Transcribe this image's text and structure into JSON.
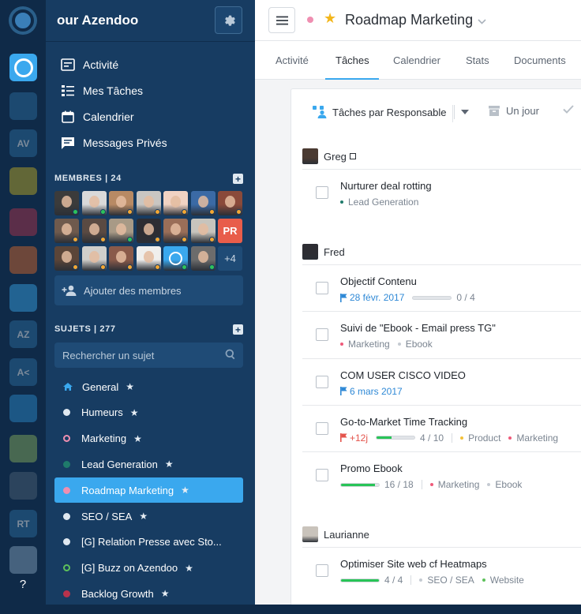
{
  "rail": {
    "workspaces": [
      {
        "label": "",
        "kind": "azendoo-active",
        "color": "#3aa8ee"
      },
      {
        "label": "",
        "kind": "logo",
        "color": "#2d6fa1"
      },
      {
        "label": "AV",
        "kind": "initials",
        "color": "#2d6fa1"
      },
      {
        "label": "",
        "kind": "logo",
        "color": "#c7b223"
      },
      {
        "label": "",
        "kind": "logo",
        "color": "#b8324c"
      },
      {
        "label": "",
        "kind": "logo",
        "color": "#e06b2b"
      },
      {
        "label": "",
        "kind": "logo",
        "color": "#3aa8ee"
      },
      {
        "label": "AZ",
        "kind": "initials",
        "color": "#2d6fa1"
      },
      {
        "label": "A<",
        "kind": "initials",
        "color": "#2d6fa1"
      },
      {
        "label": "",
        "kind": "logo",
        "color": "#2d8fd0"
      },
      {
        "label": "",
        "kind": "logo",
        "color": "#8fb35d"
      },
      {
        "label": "",
        "kind": "logo",
        "color": "#4f6377"
      },
      {
        "label": "RT",
        "kind": "initials",
        "color": "#2d6fa1"
      },
      {
        "label": "",
        "kind": "logo",
        "color": "#8aa7c0"
      }
    ],
    "help_label": "?"
  },
  "sidebar": {
    "workspace_title": "our Azendoo",
    "nav": [
      {
        "label": "Activité",
        "icon": "activity-icon"
      },
      {
        "label": "Mes Tâches",
        "icon": "tasks-list-icon"
      },
      {
        "label": "Calendrier",
        "icon": "calendar-icon"
      },
      {
        "label": "Messages Privés",
        "icon": "chat-icon"
      }
    ],
    "members_heading": "MEMBRES | 24",
    "members": [
      {
        "color": "#3b3b3b",
        "status": "#2ec35a"
      },
      {
        "color": "#d9d9d9",
        "status": "#2ec35a"
      },
      {
        "color": "#b88a64",
        "status": "#f4a732"
      },
      {
        "color": "#c9c6c2",
        "status": "#f4a732"
      },
      {
        "color": "#f1d3c3",
        "status": "#f4a732"
      },
      {
        "color": "#3b6aa5",
        "status": "#f4a732"
      },
      {
        "color": "#8a4a3a",
        "status": "#f4a732"
      },
      {
        "color": "#6f5a4d",
        "status": "#f4a732"
      },
      {
        "color": "#5a4a42",
        "status": "#f4a732"
      },
      {
        "color": "#a89a86",
        "status": "#2ec35a"
      },
      {
        "color": "#2d2d33",
        "status": "#f4a732"
      },
      {
        "color": "#9a6e58",
        "status": "#f4a732"
      },
      {
        "color": "#c7c4bd",
        "status": "#f4a732"
      },
      {
        "initials": "PR",
        "color": "#e85d4a"
      },
      {
        "color": "#5b4538",
        "status": "#f4a732"
      },
      {
        "color": "#d0cfcb",
        "status": "#f4a732"
      },
      {
        "color": "#8a5a4a",
        "status": "#f4a732"
      },
      {
        "color": "#f0efed",
        "status": "#f4a732"
      },
      {
        "color": "#3aa8ee",
        "status": "#2ec35a",
        "azendoo": true
      },
      {
        "color": "#6c6c6c",
        "status": "#2ec35a"
      },
      {
        "more": "+4"
      }
    ],
    "add_members_label": "Ajouter des membres",
    "subjects_heading": "SUJETS | 277",
    "search_placeholder": "Rechercher un sujet",
    "subjects": [
      {
        "label": "General",
        "star": "★",
        "icon": "house",
        "color": "#3aa8ee"
      },
      {
        "label": "Humeurs",
        "star": "★",
        "icon": "dot",
        "color": "#dfe8f0"
      },
      {
        "label": "Marketing",
        "star": "★",
        "icon": "ring",
        "color": "#ef8fb1"
      },
      {
        "label": "Lead Generation",
        "star": "★",
        "icon": "dot",
        "color": "#1f7b6b"
      },
      {
        "label": "Roadmap Marketing",
        "star": "★",
        "icon": "dot",
        "color": "#ef8fb1",
        "active": true
      },
      {
        "label": "SEO / SEA",
        "star": "★",
        "icon": "dot",
        "color": "#dfe8f0"
      },
      {
        "label": "[G] Relation Presse avec Sto...",
        "star": "",
        "icon": "dot",
        "color": "#dfe8f0"
      },
      {
        "label": "[G] Buzz on Azendoo",
        "star": "★",
        "icon": "ring",
        "color": "#5ec15b"
      },
      {
        "label": "Backlog Growth",
        "star": "★",
        "icon": "dot",
        "color": "#b8324c"
      }
    ]
  },
  "main": {
    "project_title": "Roadmap Marketing",
    "title_star": "★",
    "tabs": [
      {
        "label": "Activité"
      },
      {
        "label": "Tâches",
        "active": true
      },
      {
        "label": "Calendrier"
      },
      {
        "label": "Stats"
      },
      {
        "label": "Documents"
      }
    ],
    "toolbar": {
      "group_by_label": "Tâches par Responsable",
      "period_label": "Un jour"
    },
    "groups": [
      {
        "name": "Greg",
        "photo": "#4a3a32",
        "tasks": [
          {
            "title": "Nurturer deal rotting",
            "tags": [
              {
                "label": "Lead Generation",
                "color": "#1f7b6b"
              }
            ]
          }
        ]
      },
      {
        "name": "Fred",
        "photo": "#2d2d33",
        "tasks": [
          {
            "title": "Objectif Contenu",
            "date": "28 févr. 2017",
            "progress": {
              "fraction": 0,
              "label": "0 / 4"
            }
          },
          {
            "title": "Suivi de \"Ebook - Email press TG\"",
            "tags": [
              {
                "label": "Marketing",
                "color": "#ef5a7a"
              },
              {
                "label": "Ebook",
                "color": "#c5cbd2"
              }
            ]
          },
          {
            "title": "COM USER CISCO VIDEO",
            "date": "6 mars 2017"
          },
          {
            "title": "Go-to-Market Time Tracking",
            "late": "+12j",
            "progress": {
              "fraction": 0.4,
              "label": "4 / 10"
            },
            "tags": [
              {
                "label": "Product",
                "color": "#f3c13a"
              },
              {
                "label": "Marketing",
                "color": "#ef5a7a"
              }
            ]
          },
          {
            "title": "Promo Ebook",
            "progress": {
              "fraction": 0.889,
              "label": "16 / 18"
            },
            "tags": [
              {
                "label": "Marketing",
                "color": "#ef5a7a"
              },
              {
                "label": "Ebook",
                "color": "#c5cbd2"
              }
            ]
          }
        ]
      },
      {
        "name": "Laurianne",
        "photo": "#c9c3bb",
        "tasks": [
          {
            "title": "Optimiser Site web cf Heatmaps",
            "progress": {
              "fraction": 1,
              "label": "4 / 4"
            },
            "tags": [
              {
                "label": "SEO / SEA",
                "color": "#c5cbd2"
              },
              {
                "label": "Website",
                "color": "#5ec15b"
              }
            ]
          }
        ]
      }
    ]
  }
}
